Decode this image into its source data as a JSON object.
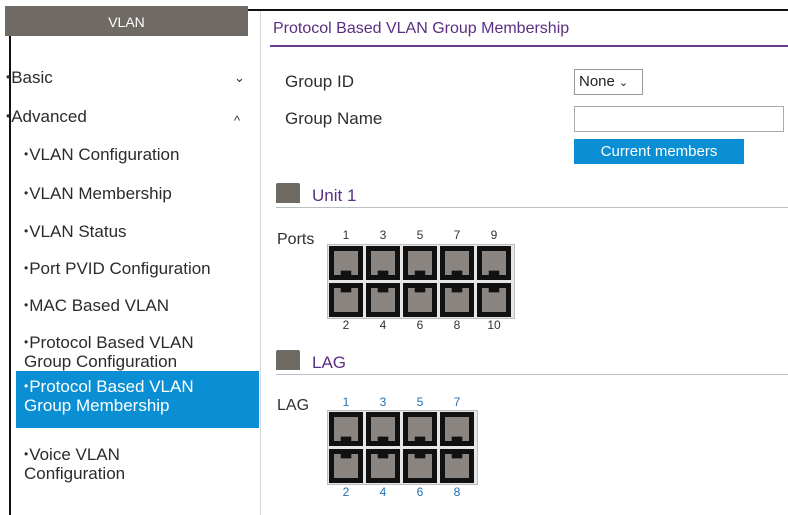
{
  "sidebar": {
    "header": "VLAN",
    "basic": "Basic",
    "advanced": "Advanced",
    "items": [
      "VLAN Configuration",
      "VLAN Membership",
      "VLAN Status",
      "Port PVID Configuration",
      "MAC Based VLAN"
    ],
    "protocol_config_1": "Protocol Based VLAN",
    "protocol_config_2": "Group Configuration",
    "active_1": "Protocol Based VLAN",
    "active_2": "Group Membership",
    "voice_1": "Voice VLAN",
    "voice_2": "Configuration"
  },
  "main": {
    "title": "Protocol Based VLAN Group Membership",
    "group_id_label": "Group ID",
    "group_id_value": "None",
    "group_name_label": "Group Name",
    "current_members_button": "Current members",
    "unit_title": "Unit 1",
    "ports_label": "Ports",
    "ports_top": [
      "1",
      "3",
      "5",
      "7",
      "9"
    ],
    "ports_bottom": [
      "2",
      "4",
      "6",
      "8",
      "10"
    ],
    "lag_title": "LAG",
    "lag_label": "LAG",
    "lag_top": [
      "1",
      "3",
      "5",
      "7"
    ],
    "lag_bottom": [
      "2",
      "4",
      "6",
      "8"
    ]
  },
  "colors": {
    "accent": "#0a8fd4",
    "title": "#5a2e82",
    "header": "#6f6a63"
  }
}
